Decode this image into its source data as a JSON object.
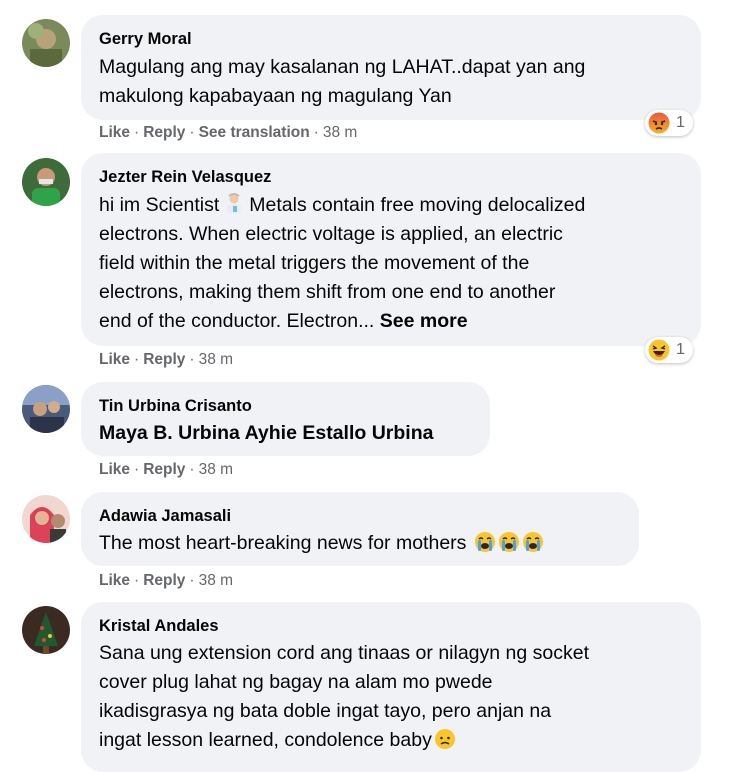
{
  "comments": [
    {
      "author": "Gerry Moral",
      "text_lines": [
        "Magulang ang may kasalanan ng LAHAT..dapat yan ang",
        "makulong kapabayaan ng magulang Yan"
      ],
      "actions": {
        "like": "Like",
        "reply": "Reply",
        "see_translation": "See translation",
        "time": "38 m"
      },
      "reaction": {
        "icon": "angry-emoji-icon",
        "count": "1"
      }
    },
    {
      "author": "Jezter Rein Velasquez",
      "text_first": "hi im Scientist",
      "text_lines": [
        "electrons. When electric voltage is applied, an electric",
        "field within the metal triggers the movement of the",
        "electrons, making them shift from one end to another"
      ],
      "text_first_rest": "Metals contain free moving delocalized",
      "text_last": "end of the conductor. Electron...",
      "see_more": "See more",
      "actions": {
        "like": "Like",
        "reply": "Reply",
        "time": "38 m"
      },
      "reaction": {
        "icon": "haha-emoji-icon",
        "count": "1"
      }
    },
    {
      "author": "Tin Urbina Crisanto",
      "text": "Maya B. Urbina Ayhie Estallo Urbina",
      "actions": {
        "like": "Like",
        "reply": "Reply",
        "time": "38 m"
      }
    },
    {
      "author": "Adawia Jamasali",
      "text": "The most heart-breaking news for mothers",
      "actions": {
        "like": "Like",
        "reply": "Reply",
        "time": "38 m"
      }
    },
    {
      "author": "Kristal Andales",
      "text_lines": [
        "Sana ung extension cord ang tinaas or nilagyn ng socket",
        "cover plug lahat ng bagay na alam mo pwede",
        "ikadisgrasya ng bata doble ingat tayo, pero anjan na",
        "ingat lesson learned, condolence baby"
      ]
    }
  ],
  "separator": "·"
}
